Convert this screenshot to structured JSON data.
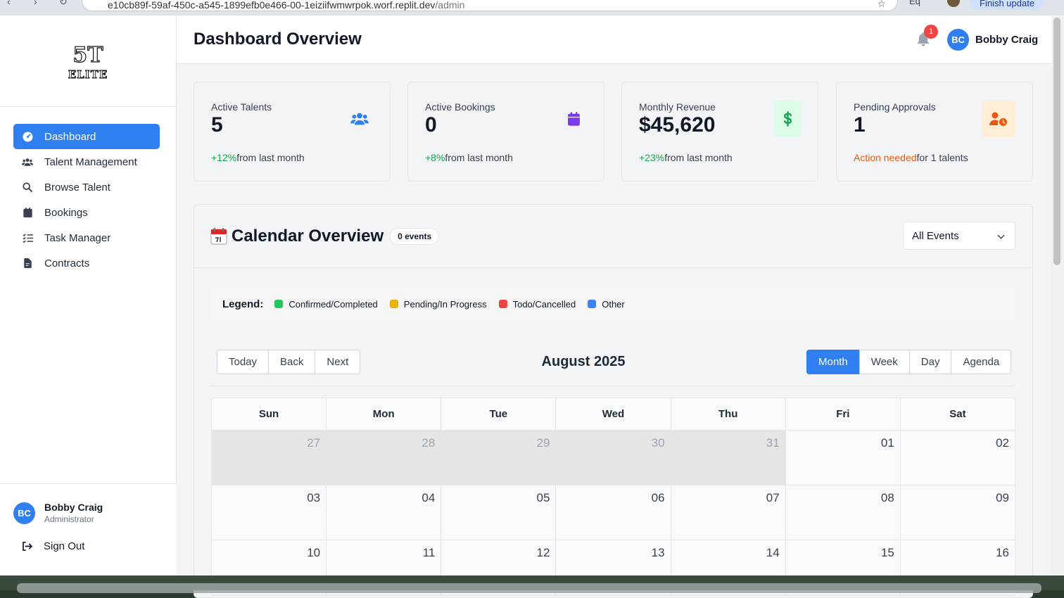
{
  "browser": {
    "url_main": "e10cb89f-59af-450c-a545-1899efb0e466-00-1eiziifwmwrpok.worf.replit.dev",
    "url_path": "/admin",
    "extension_label": "Eq",
    "finish_update_label": "Finish update"
  },
  "logo": {
    "line1": "5T",
    "line2": "ELITE"
  },
  "sidebar": {
    "items": [
      {
        "label": "Dashboard",
        "icon": "dashboard-gauge-icon",
        "active": true
      },
      {
        "label": "Talent Management",
        "icon": "users-icon",
        "active": false
      },
      {
        "label": "Browse Talent",
        "icon": "search-icon",
        "active": false
      },
      {
        "label": "Bookings",
        "icon": "calendar-icon",
        "active": false
      },
      {
        "label": "Task Manager",
        "icon": "checklist-icon",
        "active": false
      },
      {
        "label": "Contracts",
        "icon": "document-icon",
        "active": false
      }
    ],
    "user": {
      "initials": "BC",
      "name": "Bobby Craig",
      "role": "Administrator"
    },
    "sign_out_label": "Sign Out"
  },
  "header": {
    "title": "Dashboard Overview",
    "notification_count": "1",
    "user": {
      "initials": "BC",
      "name": "Bobby Craig"
    }
  },
  "stats": [
    {
      "label": "Active Talents",
      "value": "5",
      "change": "+12%",
      "suffix": "from last month",
      "icon": "users-icon",
      "icon_color": "#2f7ff0",
      "icon_bg": "transparent"
    },
    {
      "label": "Active Bookings",
      "value": "0",
      "change": "+8%",
      "suffix": "from last month",
      "icon": "calendar-icon",
      "icon_color": "#7c3aed",
      "icon_bg": "transparent"
    },
    {
      "label": "Monthly Revenue",
      "value": "$45,620",
      "change": "+23%",
      "suffix": "from last month",
      "icon": "dollar-icon",
      "icon_color": "#16a34a",
      "icon_bg": "#dcfce7"
    },
    {
      "label": "Pending Approvals",
      "value": "1",
      "change": "Action needed",
      "suffix": "for 1 talents",
      "icon": "user-clock-icon",
      "icon_color": "#ea580c",
      "icon_bg": "#ffedd5"
    }
  ],
  "calendar": {
    "title": "Calendar Overview",
    "events_badge": "0 events",
    "filter_value": "All Events",
    "legend_title": "Legend:",
    "legend": [
      {
        "label": "Confirmed/Completed",
        "color": "#22c55e"
      },
      {
        "label": "Pending/In Progress",
        "color": "#eab308"
      },
      {
        "label": "Todo/Cancelled",
        "color": "#ef4444"
      },
      {
        "label": "Other",
        "color": "#3b82f6"
      }
    ],
    "nav_buttons": [
      "Today",
      "Back",
      "Next"
    ],
    "month_label": "August 2025",
    "views": [
      {
        "label": "Month",
        "active": true
      },
      {
        "label": "Week",
        "active": false
      },
      {
        "label": "Day",
        "active": false
      },
      {
        "label": "Agenda",
        "active": false
      }
    ],
    "weekdays": [
      "Sun",
      "Mon",
      "Tue",
      "Wed",
      "Thu",
      "Fri",
      "Sat"
    ],
    "weeks": [
      [
        {
          "d": "27",
          "off": true
        },
        {
          "d": "28",
          "off": true
        },
        {
          "d": "29",
          "off": true
        },
        {
          "d": "30",
          "off": true
        },
        {
          "d": "31",
          "off": true
        },
        {
          "d": "01",
          "off": false
        },
        {
          "d": "02",
          "off": false
        }
      ],
      [
        {
          "d": "03",
          "off": false
        },
        {
          "d": "04",
          "off": false
        },
        {
          "d": "05",
          "off": false
        },
        {
          "d": "06",
          "off": false
        },
        {
          "d": "07",
          "off": false
        },
        {
          "d": "08",
          "off": false
        },
        {
          "d": "09",
          "off": false
        }
      ],
      [
        {
          "d": "10",
          "off": false
        },
        {
          "d": "11",
          "off": false
        },
        {
          "d": "12",
          "off": false
        },
        {
          "d": "13",
          "off": false
        },
        {
          "d": "14",
          "off": false
        },
        {
          "d": "15",
          "off": false
        },
        {
          "d": "16",
          "off": false
        }
      ]
    ]
  }
}
